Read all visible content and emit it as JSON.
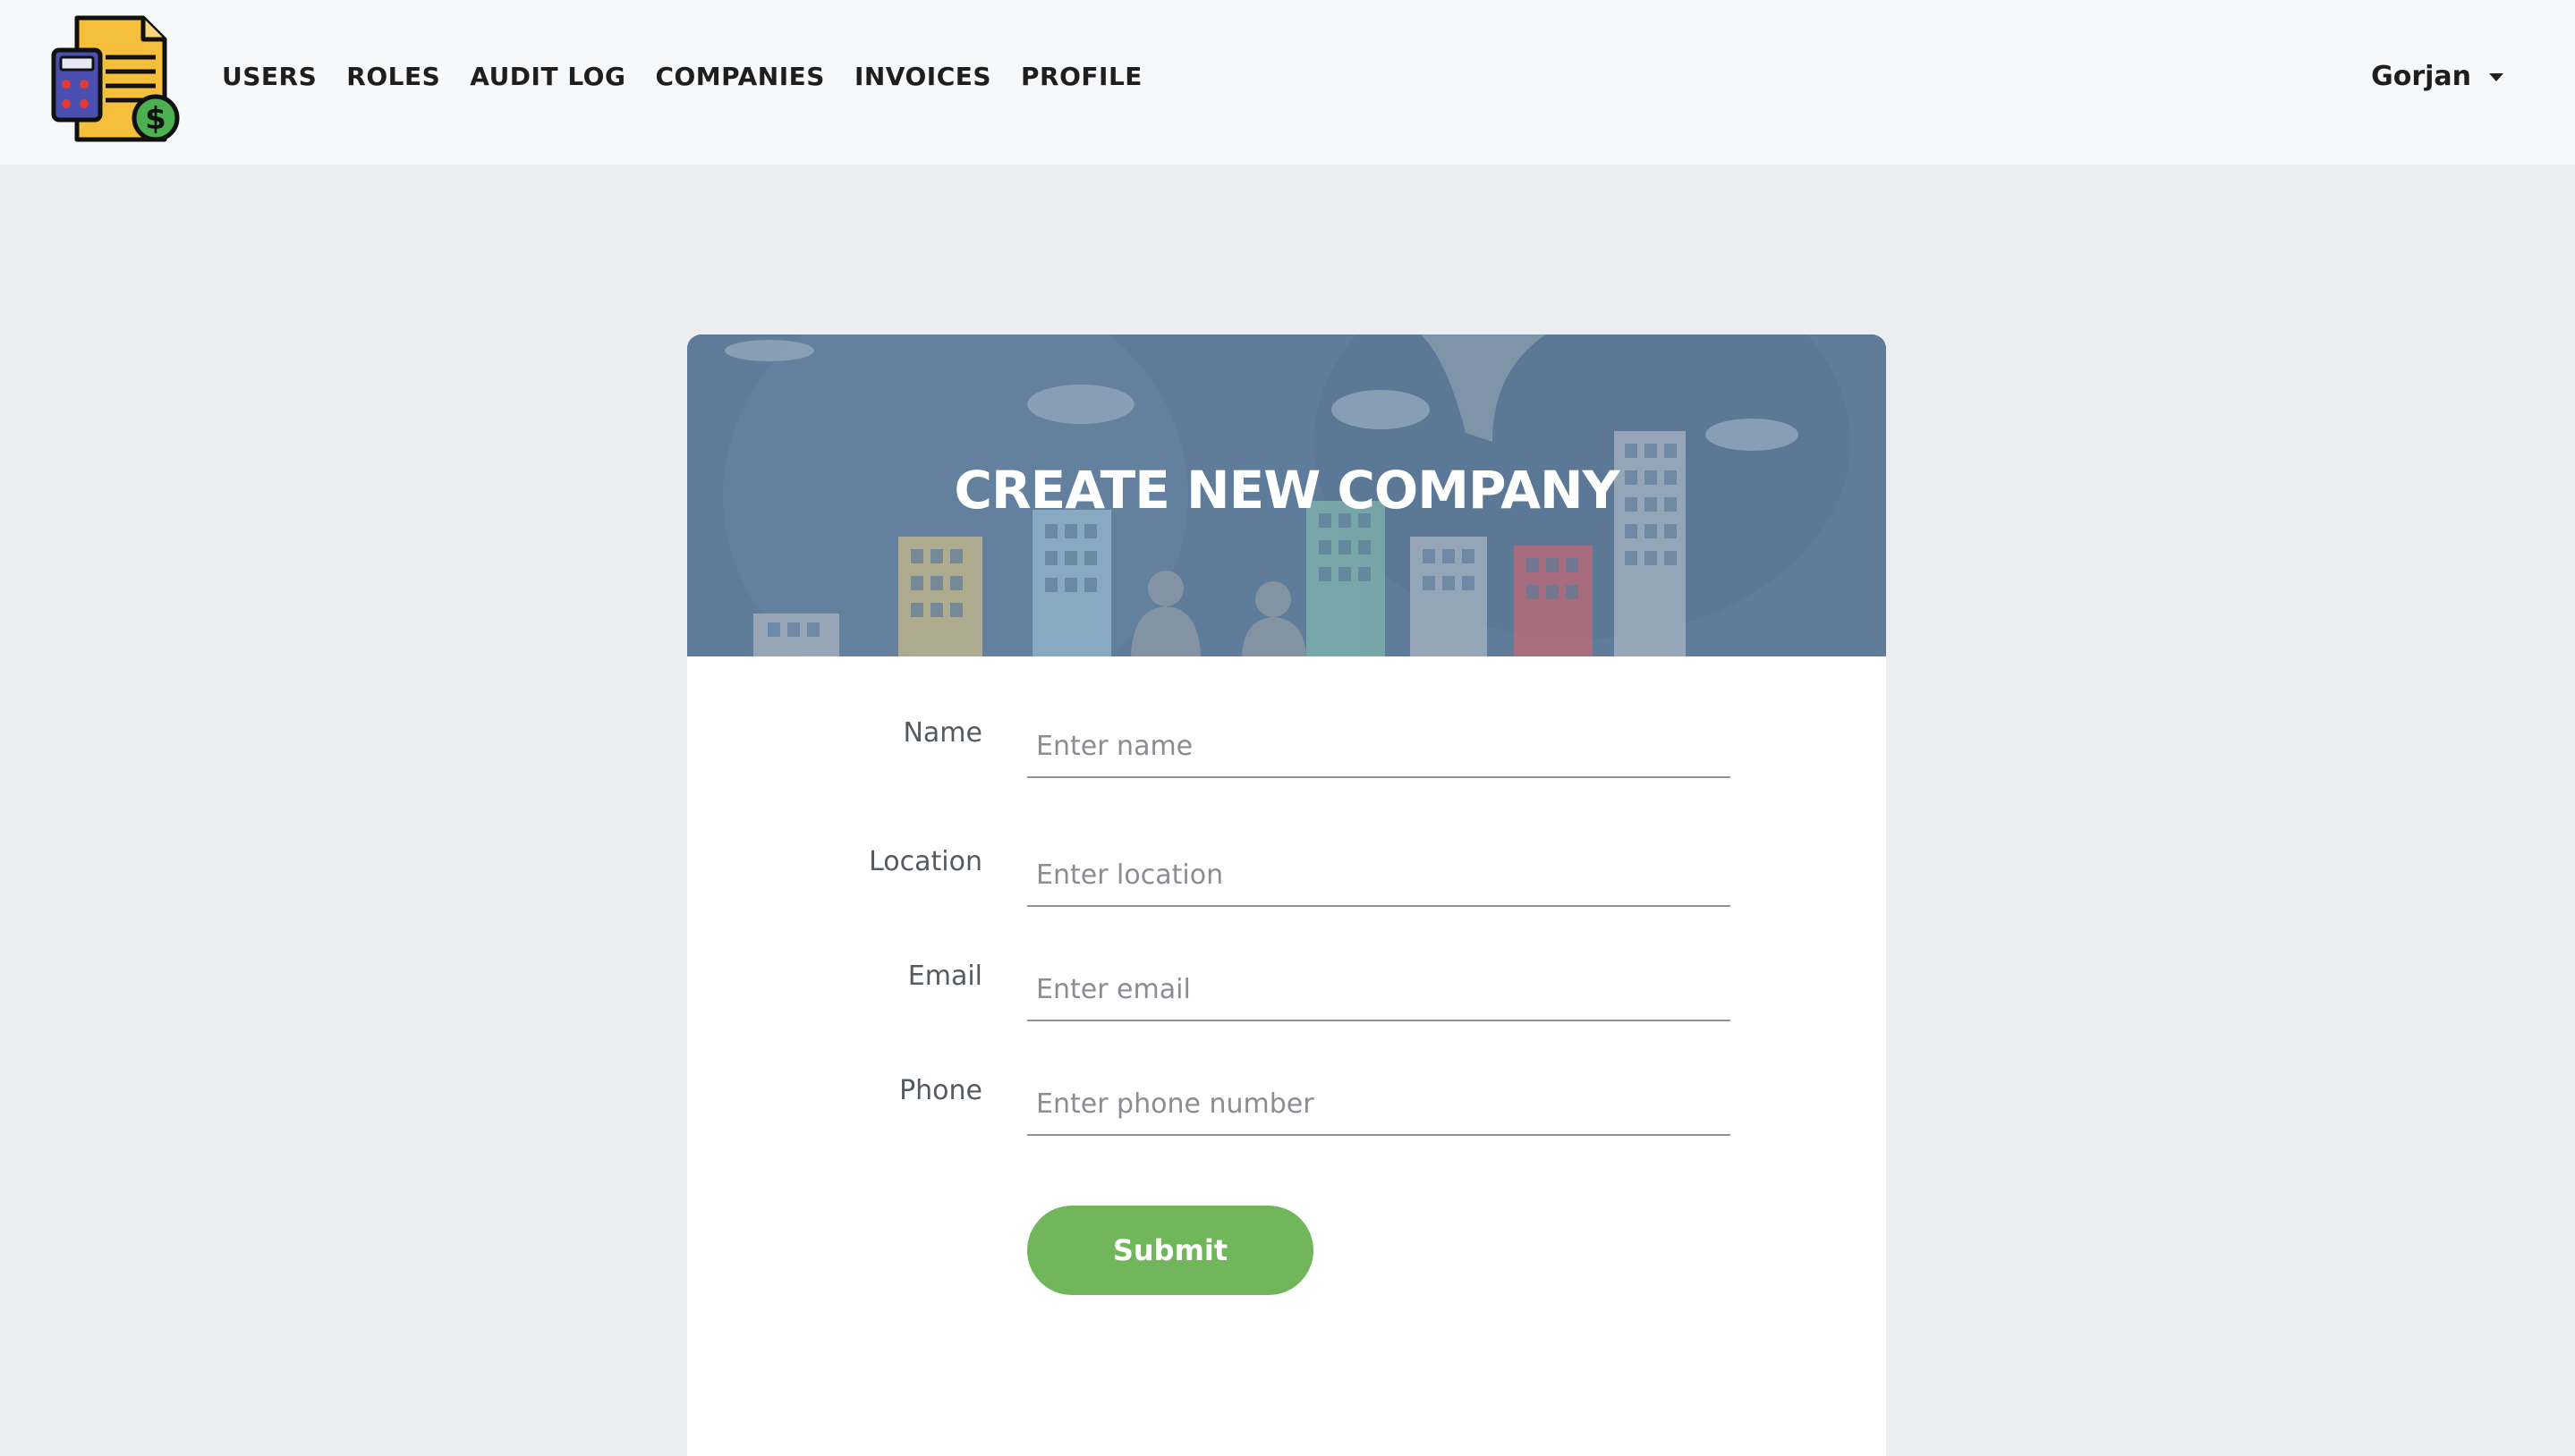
{
  "nav": {
    "logo_icon": "invoice-calculator-logo-icon",
    "links": [
      "USERS",
      "ROLES",
      "AUDIT LOG",
      "COMPANIES",
      "INVOICES",
      "PROFILE"
    ],
    "user_name": "Gorjan",
    "user_menu_icon": "caret-down-icon"
  },
  "card": {
    "title": "CREATE NEW COMPANY",
    "banner_image": "business-city-skyline-banner",
    "fields": [
      {
        "label": "Name",
        "placeholder": "Enter name",
        "value": ""
      },
      {
        "label": "Location",
        "placeholder": "Enter location",
        "value": ""
      },
      {
        "label": "Email",
        "placeholder": "Enter email",
        "value": ""
      },
      {
        "label": "Phone",
        "placeholder": "Enter phone number",
        "value": ""
      }
    ],
    "submit_label": "Submit"
  },
  "colors": {
    "navbar_bg": "#f7f8fa",
    "page_bg": "#ecedee",
    "submit_green": "#72b65c",
    "banner_blue": "#5d7a99"
  }
}
